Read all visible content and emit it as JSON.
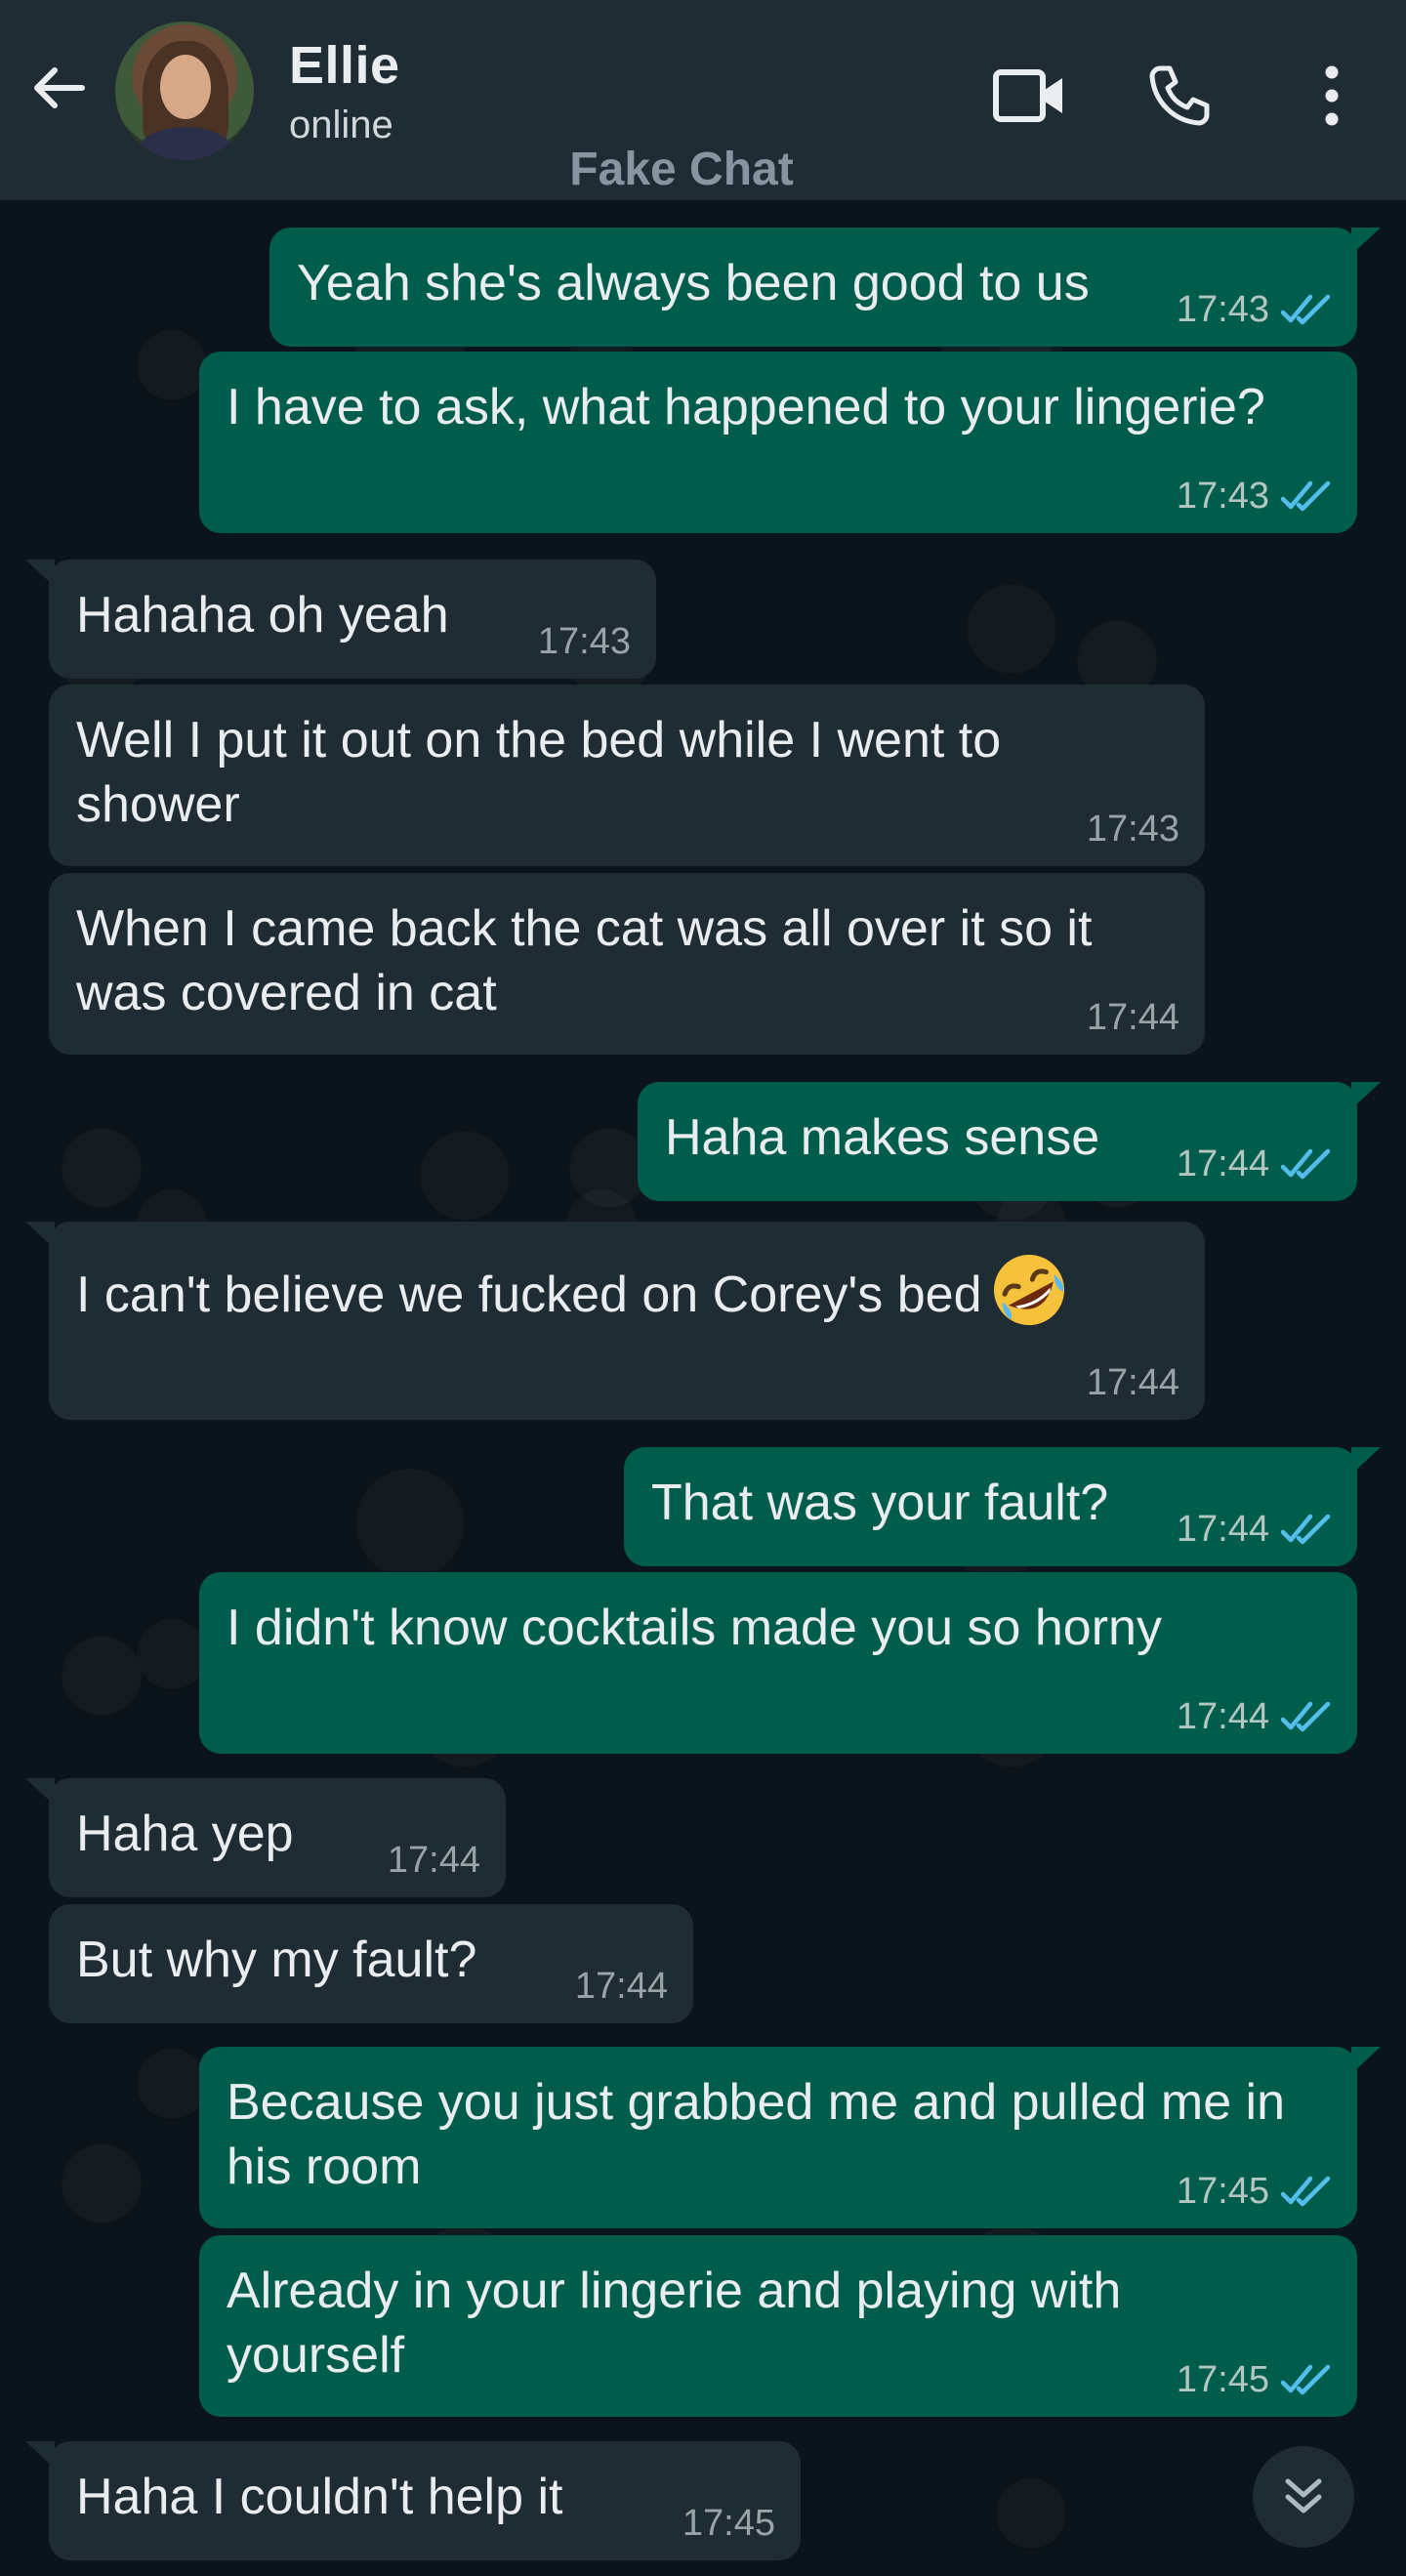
{
  "header": {
    "name": "Ellie",
    "status": "online",
    "watermark": "Fake Chat"
  },
  "colors": {
    "header_bg": "#1f2c34",
    "chat_bg": "#0b141a",
    "outgoing_bubble": "#005c4b",
    "incoming_bubble": "#202c33",
    "read_tick": "#53bdeb"
  },
  "icons": {
    "back": "arrow-left-icon",
    "video": "video-camera-icon",
    "call": "phone-icon",
    "menu": "more-vertical-icon",
    "scroll_down": "double-chevron-down-icon"
  },
  "messages": [
    {
      "dir": "out",
      "text": "Yeah she's always been good to us",
      "time": "17:43",
      "read": true
    },
    {
      "dir": "out",
      "text": "I have to ask, what happened to your lingerie?",
      "time": "17:43",
      "read": true
    },
    {
      "dir": "in",
      "text": "Hahaha oh yeah",
      "time": "17:43"
    },
    {
      "dir": "in",
      "text": "Well I put it out on the bed while I went to shower",
      "time": "17:43"
    },
    {
      "dir": "in",
      "text": "When I came back the cat was all over it so it was covered in cat",
      "time": "17:44"
    },
    {
      "dir": "out",
      "text": "Haha makes sense",
      "time": "17:44",
      "read": true
    },
    {
      "dir": "in",
      "text": "I can't believe we fucked on Corey's bed",
      "emoji": "rolling-on-floor-laughing",
      "time": "17:44"
    },
    {
      "dir": "out",
      "text": "That was your fault?",
      "time": "17:44",
      "read": true
    },
    {
      "dir": "out",
      "text": "I didn't know cocktails made you so horny",
      "time": "17:44",
      "read": true
    },
    {
      "dir": "in",
      "text": "Haha yep",
      "time": "17:44"
    },
    {
      "dir": "in",
      "text": "But why my fault?",
      "time": "17:44"
    },
    {
      "dir": "out",
      "text": "Because you just grabbed me and pulled me in his room",
      "time": "17:45",
      "read": true
    },
    {
      "dir": "out",
      "text": "Already in your lingerie and playing with yourself",
      "time": "17:45",
      "read": true
    },
    {
      "dir": "in",
      "text": "Haha I couldn't help it",
      "time": "17:45"
    }
  ]
}
